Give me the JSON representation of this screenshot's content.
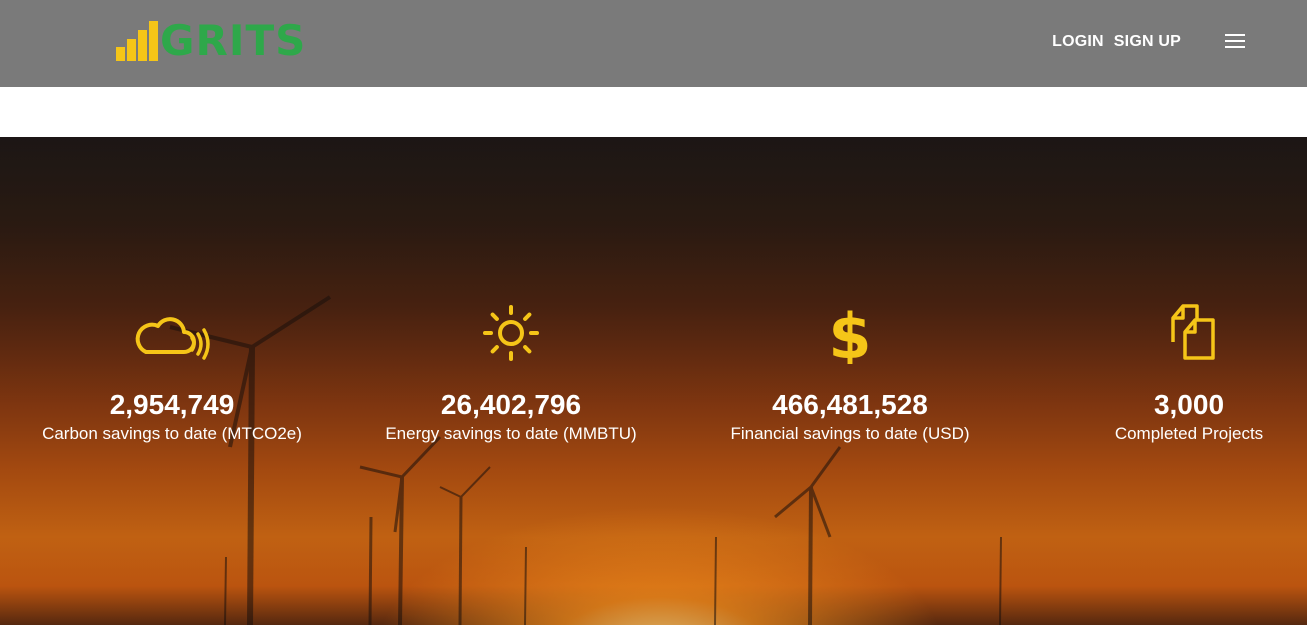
{
  "brand": {
    "name": "GRITS",
    "logo_icon": "bar-chart-logo-icon",
    "bar_color": "#f5c518",
    "text_color": "#2ea84a"
  },
  "nav": {
    "login": "LOGIN",
    "signup": "SIGN UP",
    "menu_icon": "hamburger-menu-icon"
  },
  "colors": {
    "header_bg": "#7a7a7a",
    "icon_accent": "#f5c518",
    "text": "#ffffff"
  },
  "stats": [
    {
      "icon": "cloud-wind-icon",
      "value": "2,954,749",
      "label": "Carbon savings to date (MTCO2e)"
    },
    {
      "icon": "sun-icon",
      "value": "26,402,796",
      "label": "Energy savings to date (MMBTU)"
    },
    {
      "icon": "dollar-icon",
      "value": "466,481,528",
      "label": "Financial savings to date (USD)"
    },
    {
      "icon": "documents-icon",
      "value": "3,000",
      "label": "Completed Projects"
    }
  ]
}
